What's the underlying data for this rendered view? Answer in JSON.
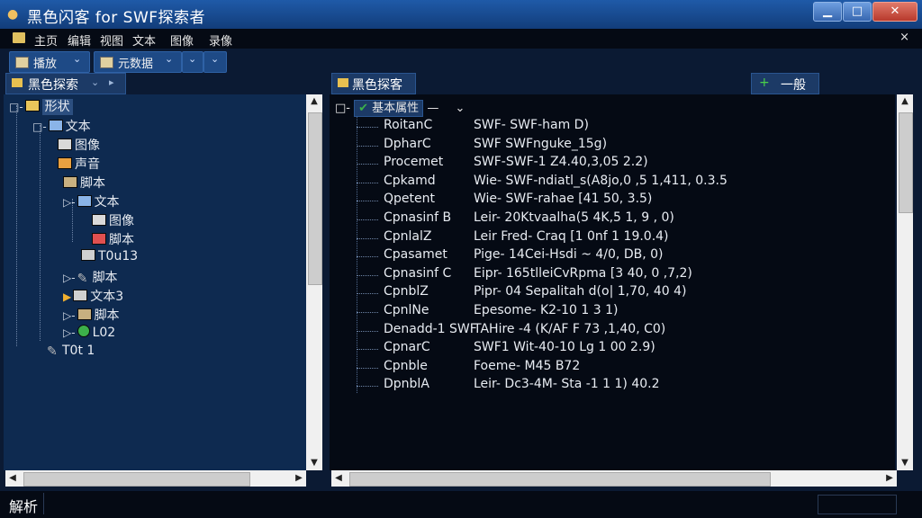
{
  "window": {
    "title": "黑色闪客 for SWF探索者",
    "min_glyph": "▁",
    "max_glyph": "□",
    "close_glyph": "✕"
  },
  "menu": {
    "items": [
      "主页",
      "编辑",
      "视图",
      "文本",
      "图像",
      "录像"
    ],
    "close_glyph": "×"
  },
  "toolbar": {
    "group1_label": "播放",
    "group1_arrow": "⌄",
    "group2_label": "元数据",
    "group2_arrow": "⌄",
    "extra_arrow_1": "⌄",
    "extra_arrow_2": "⌄"
  },
  "left_panel": {
    "tab_label": "黑色探索",
    "tab_arrow": "⌄",
    "tab_arrow2": "▸"
  },
  "tree": [
    {
      "label": "形状",
      "exp": "□-",
      "icon": "folder",
      "selected": true
    },
    {
      "label": "文本",
      "exp": "□-",
      "icon": "folder-open"
    },
    {
      "label": "图像",
      "exp": "",
      "icon": "img"
    },
    {
      "label": "声音",
      "exp": "",
      "icon": "sound"
    },
    {
      "label": "脚本",
      "exp": "",
      "icon": "script"
    },
    {
      "label": "文本",
      "exp": "▷-",
      "icon": "folder-open"
    },
    {
      "label": "图像",
      "exp": "",
      "icon": "img"
    },
    {
      "label": "脚本",
      "exp": "",
      "icon": "shape"
    },
    {
      "label": "T0u13",
      "exp": "",
      "icon": "clip"
    },
    {
      "label": "脚本",
      "exp": "▷-",
      "icon": "pen"
    },
    {
      "label": "文本3",
      "exp": "▶",
      "icon": "clip"
    },
    {
      "label": "脚本",
      "exp": "▷-",
      "icon": "script"
    },
    {
      "label": "L02",
      "exp": "▷-",
      "icon": "check"
    },
    {
      "label": "T0t 1",
      "exp": "",
      "icon": "pen"
    }
  ],
  "right_panel": {
    "tab_label": "黑色探客",
    "action_icon": "+",
    "action_label": "一般",
    "root_exp": "□-",
    "root_label": "基本属性",
    "root_dash": "—",
    "root_arrow": "⌄"
  },
  "properties": [
    {
      "name": "RoitanC",
      "value": "SWF- SWF-ham D)"
    },
    {
      "name": "DpharC",
      "value": "SWF SWFnguke_15g)"
    },
    {
      "name": "Procemet",
      "value": "SWF-SWF-1 Z4.40,3,05 2.2)"
    },
    {
      "name": "Cpkamd",
      "value": "Wie- SWF-ndiatl_s(A8jo,0 ,5 1,411, 0.3.5"
    },
    {
      "name": "Qpetent",
      "value": "Wie- SWF-rahae [41 50, 3.5)"
    },
    {
      "name": "Cpnasinf B",
      "value": "Leir- 20Ktvaalha(5 4K,5 1, 9 , 0)"
    },
    {
      "name": "CpnlalZ",
      "value": "Leir Fred- Craq [1 0nf 1 19.0.4)"
    },
    {
      "name": "Cpasamet",
      "value": "Pige- 14Cei-Hsdi ~ 4/0, DB, 0)"
    },
    {
      "name": "Cpnasinf C",
      "value": "Eipr- 165tlleiCvRpma [3 40, 0 ,7,2)"
    },
    {
      "name": "CpnblZ",
      "value": "Pipr- 04 Sepalitah d(o| 1,70, 40 4)"
    },
    {
      "name": "CpnlNe",
      "value": "Epesome- K2-10 1 3 1)"
    },
    {
      "name": "Denadd-1 SWF",
      "value": "TAHire -4 (K/AF F 73 ,1,40, C0)"
    },
    {
      "name": "CpnarC",
      "value": "SWF1 Wit-40-10 Lg 1 00 2.9)"
    },
    {
      "name": "Cpnble",
      "value": "Foeme- M45 B72"
    },
    {
      "name": "DpnblA",
      "value": "Leir- Dc3-4M- Sta -1 1 1) 40.2"
    }
  ],
  "status": {
    "label": "解析"
  },
  "colors": {
    "background": "#0b1a33",
    "titlebar": "#1f5aa8",
    "panel_tab": "#1c3a66",
    "tree_bg": "#0e2a50",
    "prop_bg": "#050a14"
  }
}
